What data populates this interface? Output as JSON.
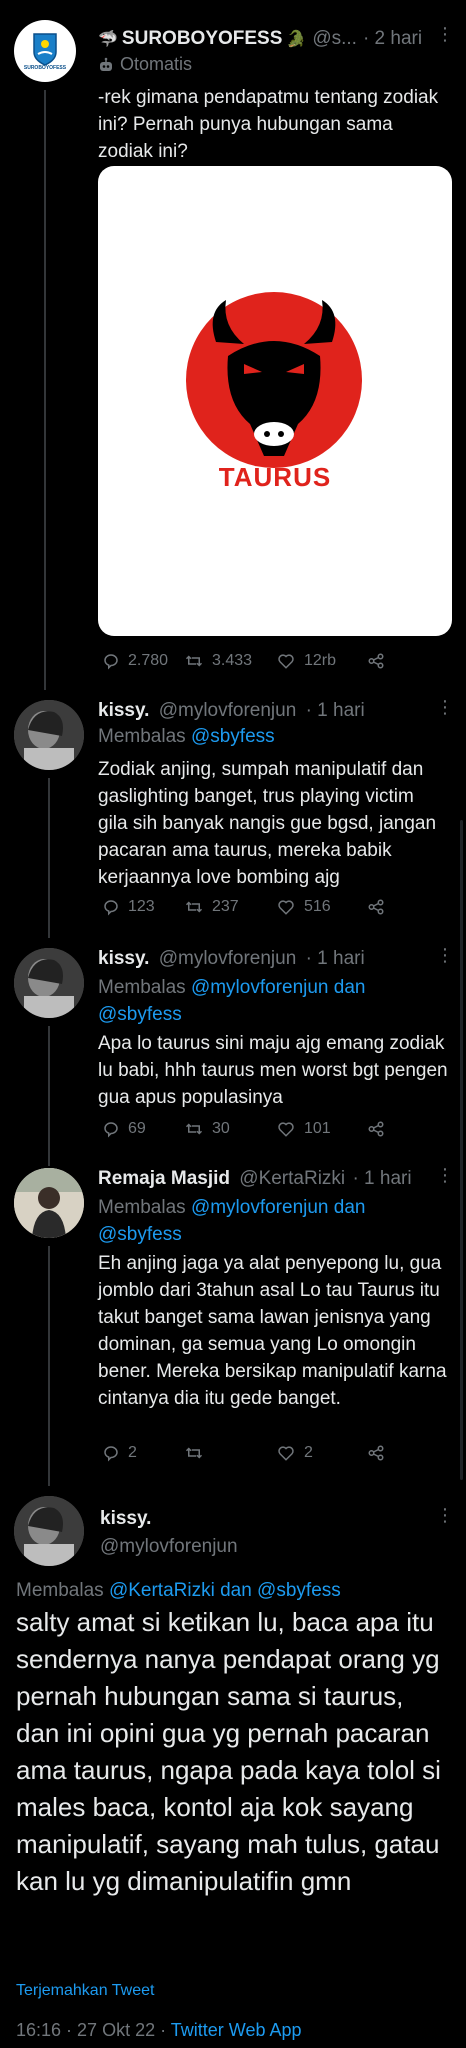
{
  "main_tweet": {
    "name": "SUROBOYOFESS",
    "name_suffix": "🐊",
    "handle": "@s...",
    "time": "· 2 hari",
    "automation_label": "Otomatis",
    "avatar_text": "SUROBOYOFESS",
    "text": "-rek gimana pendapatmu tentang zodiak ini? Pernah punya hubungan sama zodiak ini?",
    "image_label": "TAURUS",
    "replies": "2.780",
    "retweets": "3.433",
    "likes": "12rb"
  },
  "replies": [
    {
      "name": "kissy.",
      "handle": "@mylovforenjun",
      "time": "· 1 hari",
      "reply_prefix": "Membalas",
      "reply_to": "@sbyfess",
      "text": "Zodiak anjing, sumpah manipulatif dan gaslighting banget, trus playing victim gila sih banyak nangis gue bgsd, jangan pacaran ama taurus, mereka babik kerjaannya love bombing ajg",
      "replies": "123",
      "retweets": "237",
      "likes": "516"
    },
    {
      "name": "kissy.",
      "handle": "@mylovforenjun",
      "time": "· 1 hari",
      "reply_prefix": "Membalas",
      "reply_to": "@mylovforenjun dan @sbyfess",
      "text": "Apa lo taurus sini maju ajg emang zodiak lu babi, hhh taurus men worst bgt pengen gua apus populasinya",
      "replies": "69",
      "retweets": "30",
      "likes": "101"
    },
    {
      "name": "Remaja Masjid",
      "handle": "@KertaRizki",
      "time": "· 1 hari",
      "reply_prefix": "Membalas",
      "reply_to": "@mylovforenjun dan @sbyfess",
      "text": "Eh anjing jaga ya alat penyepong lu, gua jomblo dari 3tahun asal Lo tau Taurus itu takut banget sama lawan jenisnya yang dominan, ga semua yang Lo omongin bener. Mereka bersikap manipulatif karna cintanya dia itu gede banget.",
      "replies": "2",
      "retweets": "",
      "likes": "2"
    }
  ],
  "focused_tweet": {
    "name": "kissy.",
    "handle": "@mylovforenjun",
    "reply_prefix": "Membalas",
    "reply_to": "@KertaRizki dan @sbyfess",
    "text": "salty amat si ketikan lu, baca apa itu sendernya nanya pendapat orang yg pernah hubungan sama si taurus, dan ini opini gua yg pernah pacaran ama taurus, ngapa pada kaya tolol si males baca, kontol aja kok sayang manipulatif, sayang mah tulus, gatau kan lu yg dimanipulatifin gmn",
    "translate_label": "Terjemahkan Tweet",
    "timestamp": "16:16 · 27 Okt 22 · ",
    "source": "Twitter Web App"
  },
  "colors": {
    "background": "#000000",
    "text": "#e7e9ea",
    "muted": "#71767b",
    "accent": "#1d9bf0",
    "taurus_red": "#e0231c"
  }
}
